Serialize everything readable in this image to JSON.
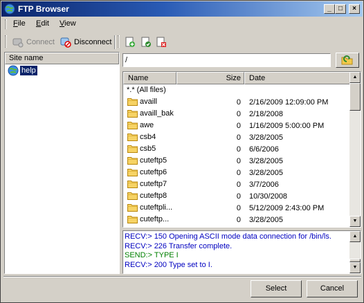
{
  "window": {
    "title": "FTP Browser",
    "controls": {
      "minimize": "_",
      "maximize": "□",
      "close": "×"
    }
  },
  "menu": [
    {
      "label": "File",
      "accel": "F",
      "rest": "ile"
    },
    {
      "label": "Edit",
      "accel": "E",
      "rest": "dit"
    },
    {
      "label": "View",
      "accel": "V",
      "rest": "iew"
    }
  ],
  "toolbar": {
    "connect_label": "Connect",
    "disconnect_label": "Disconnect",
    "tools": [
      "add-site-icon",
      "edit-site-icon",
      "delete-site-icon"
    ]
  },
  "sites": {
    "column_header": "Site name",
    "items": [
      {
        "label": "help",
        "selected": true
      }
    ]
  },
  "path": {
    "value": "/"
  },
  "files": {
    "columns": {
      "name": "Name",
      "size": "Size",
      "date": "Date"
    },
    "all_files_label": "*.* (All files)",
    "rows": [
      {
        "name": "availl",
        "size": "0",
        "date": "2/16/2009 12:09:00 PM"
      },
      {
        "name": "availl_bak",
        "size": "0",
        "date": "2/18/2008"
      },
      {
        "name": "awe",
        "size": "0",
        "date": "1/16/2009 5:00:00 PM"
      },
      {
        "name": "csb4",
        "size": "0",
        "date": "3/28/2005"
      },
      {
        "name": "csb5",
        "size": "0",
        "date": "6/6/2006"
      },
      {
        "name": "cuteftp5",
        "size": "0",
        "date": "3/28/2005"
      },
      {
        "name": "cuteftp6",
        "size": "0",
        "date": "3/28/2005"
      },
      {
        "name": "cuteftp7",
        "size": "0",
        "date": "3/7/2006"
      },
      {
        "name": "cuteftp8",
        "size": "0",
        "date": "10/30/2008"
      },
      {
        "name": "cuteftpli...",
        "size": "0",
        "date": "5/12/2009 2:43:00 PM"
      },
      {
        "name": "cuteftp...",
        "size": "0",
        "date": "3/28/2005"
      }
    ]
  },
  "log": [
    {
      "text": "RECV:> 150 Opening ASCII mode data connection for /bin/ls.",
      "kind": "recv"
    },
    {
      "text": "RECV:> 226 Transfer complete.",
      "kind": "recv"
    },
    {
      "text": "SEND:> TYPE I",
      "kind": "send"
    },
    {
      "text": "RECV:> 200 Type set to I.",
      "kind": "recv"
    }
  ],
  "colors": {
    "recv": "#0000c0",
    "send": "#008000",
    "selection": "#0a246a"
  },
  "buttons": {
    "select": "Select",
    "cancel": "Cancel"
  }
}
